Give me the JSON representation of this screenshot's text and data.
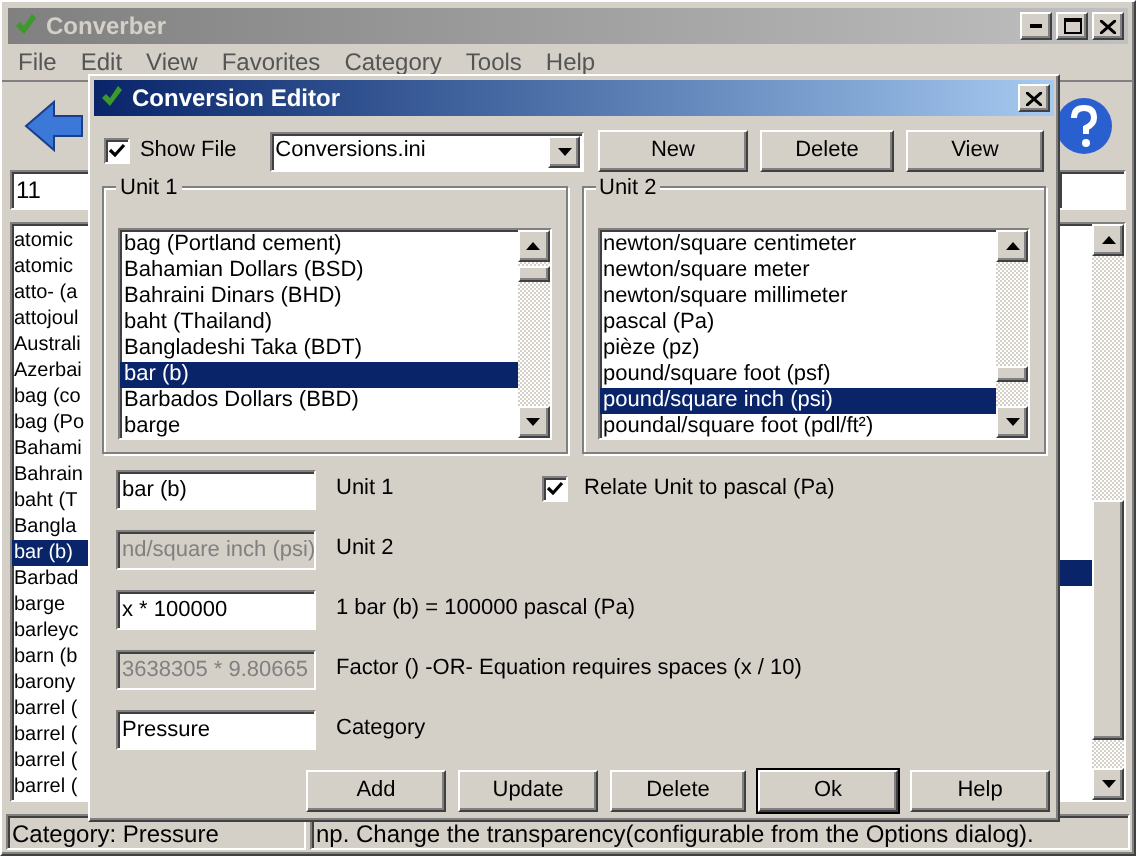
{
  "main_window": {
    "title": "Converber",
    "menu": [
      "File",
      "Edit",
      "View",
      "Favorites",
      "Category",
      "Tools",
      "Help"
    ],
    "input_value": "11",
    "units_list": [
      {
        "label": "atomic",
        "selected": false
      },
      {
        "label": "atomic",
        "selected": false
      },
      {
        "label": "atto- (a",
        "selected": false
      },
      {
        "label": "attojoul",
        "selected": false
      },
      {
        "label": "Australi",
        "selected": false
      },
      {
        "label": "Azerbai",
        "selected": false
      },
      {
        "label": "bag (co",
        "selected": false
      },
      {
        "label": "bag (Po",
        "selected": false
      },
      {
        "label": "Bahami",
        "selected": false
      },
      {
        "label": "Bahrain",
        "selected": false
      },
      {
        "label": "baht (T",
        "selected": false
      },
      {
        "label": "Bangla",
        "selected": false
      },
      {
        "label": "bar (b)",
        "selected": true
      },
      {
        "label": "Barbad",
        "selected": false
      },
      {
        "label": "barge",
        "selected": false
      },
      {
        "label": "barleyc",
        "selected": false
      },
      {
        "label": "barn (b",
        "selected": false
      },
      {
        "label": "barony",
        "selected": false
      },
      {
        "label": "barrel (",
        "selected": false
      },
      {
        "label": "barrel (",
        "selected": false
      },
      {
        "label": "barrel (",
        "selected": false
      },
      {
        "label": "barrel (",
        "selected": false
      }
    ],
    "result_row_selected": true,
    "status_bar": [
      "Category: Pressure",
      "np. Change the transparency(configurable from the Options dialog)."
    ]
  },
  "dialog": {
    "title": "Conversion Editor",
    "show_file": {
      "label": "Show File",
      "checked": true
    },
    "file_combo": {
      "value": "Conversions.ini"
    },
    "top_buttons": [
      {
        "label": "New"
      },
      {
        "label": "Delete"
      },
      {
        "label": "View"
      }
    ],
    "unit_lists": [
      {
        "title": "Unit 1",
        "items": [
          {
            "label": "bag (Portland cement)",
            "selected": false
          },
          {
            "label": "Bahamian Dollars (BSD)",
            "selected": false
          },
          {
            "label": "Bahraini Dinars (BHD)",
            "selected": false
          },
          {
            "label": "baht (Thailand)",
            "selected": false
          },
          {
            "label": "Bangladeshi Taka (BDT)",
            "selected": false
          },
          {
            "label": "bar (b)",
            "selected": true
          },
          {
            "label": "Barbados Dollars (BBD)",
            "selected": false
          },
          {
            "label": "barge",
            "selected": false
          }
        ]
      },
      {
        "title": "Unit 2",
        "items": [
          {
            "label": "newton/square centimeter",
            "selected": false
          },
          {
            "label": "newton/square meter",
            "selected": false
          },
          {
            "label": "newton/square millimeter",
            "selected": false
          },
          {
            "label": "pascal (Pa)",
            "selected": false
          },
          {
            "label": "pièze (pz)",
            "selected": false
          },
          {
            "label": "pound/square foot (psf)",
            "selected": false
          },
          {
            "label": "pound/square inch (psi)",
            "selected": true
          },
          {
            "label": "poundal/square foot (pdl/ft²)",
            "selected": false
          }
        ]
      }
    ],
    "fields": [
      {
        "value": "bar (b)",
        "disabled": false,
        "label": "Unit 1"
      },
      {
        "value": "nd/square inch (psi)",
        "disabled": true,
        "label": "Unit 2"
      },
      {
        "value": "x * 100000",
        "disabled": false,
        "label": "1 bar (b) = 100000 pascal (Pa)"
      },
      {
        "value": "3638305 * 9.80665",
        "disabled": true,
        "label": "Factor () -OR- Equation requires spaces (x / 10)"
      },
      {
        "value": "Pressure",
        "disabled": false,
        "label": "Category"
      }
    ],
    "relate": {
      "label": "Relate Unit to pascal (Pa)",
      "checked": true
    },
    "buttons": [
      {
        "label": "Add",
        "default": false
      },
      {
        "label": "Update",
        "default": false
      },
      {
        "label": "Delete",
        "default": false
      },
      {
        "label": "Ok",
        "default": true
      },
      {
        "label": "Help",
        "default": false
      }
    ]
  }
}
